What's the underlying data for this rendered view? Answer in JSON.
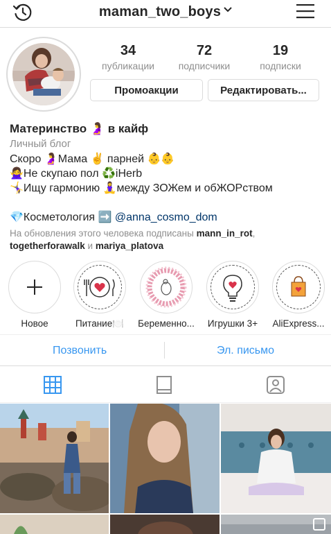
{
  "header": {
    "username": "maman_two_boys",
    "icons": [
      "history-icon",
      "chevron-down-icon",
      "menu-icon"
    ]
  },
  "stats": [
    {
      "count": "34",
      "label": "публикации"
    },
    {
      "count": "72",
      "label": "подписчики"
    },
    {
      "count": "19",
      "label": "подписки"
    }
  ],
  "buttons": {
    "promo": "Промоакции",
    "edit": "Редактировать..."
  },
  "bio": {
    "name": "Материнство 🤰 в кайф",
    "category": "Личный блог",
    "line1": "Скоро 🤰Мама ✌️ парней 👶👶",
    "line2": "🙅‍♀️Не скупаю пол ♻️iHerb",
    "line3": "🤸‍♀️Ищу гармонию 🧘‍♀️между ЗОЖем и обЖОРством",
    "line4_prefix": "💎Косметология ➡️ ",
    "line4_link": "@anna_cosmo_dom"
  },
  "followed_by": {
    "prefix": "На обновления этого человека подписаны ",
    "user1": "mann_in_rot",
    "sep": ",",
    "user2": "togetherforawalk",
    "and": " и ",
    "user3": "mariya_platova"
  },
  "highlights": [
    {
      "label": "Новое",
      "icon": "plus-icon"
    },
    {
      "label": "Питание🍽️",
      "icon": "plate-heart-icon"
    },
    {
      "label": "Беременно...",
      "icon": "pregnancy-wreath-icon"
    },
    {
      "label": "Игрушки 3+",
      "icon": "lightbulb-heart-icon"
    },
    {
      "label": "AliExpress...",
      "icon": "shopping-bag-icon"
    }
  ],
  "contact": {
    "call": "Позвонить",
    "email": "Эл. письмо"
  },
  "tabs": [
    {
      "name": "grid",
      "icon": "grid-icon",
      "active": true
    },
    {
      "name": "igtv",
      "icon": "igtv-icon",
      "active": false
    },
    {
      "name": "tagged",
      "icon": "tagged-icon",
      "active": false
    }
  ],
  "colors": {
    "link_blue": "#3897f0",
    "dark_link": "#003569",
    "border": "#dbdbdb",
    "muted": "#8e8e8e"
  }
}
